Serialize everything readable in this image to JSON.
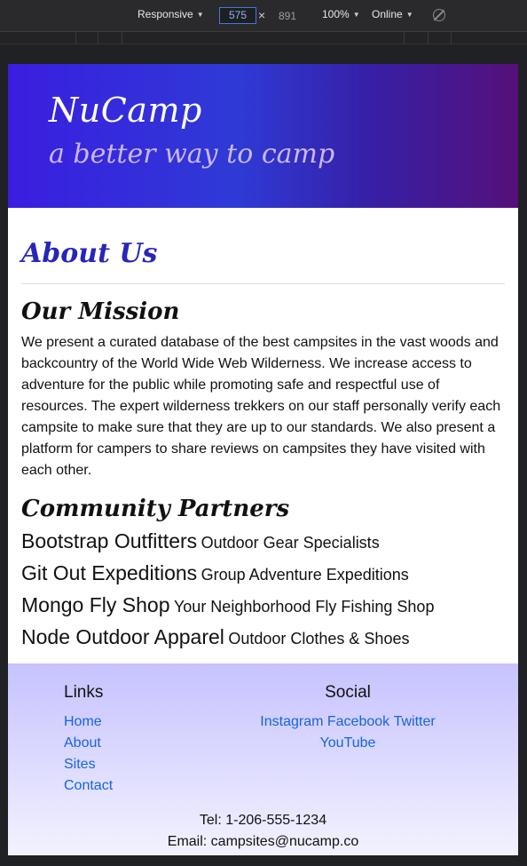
{
  "devtools": {
    "device_mode": "Responsive",
    "width_value": "575",
    "height_value": "891",
    "zoom": "100%",
    "network": "Online"
  },
  "header": {
    "brand": "NuCamp",
    "tagline": "a better way to camp"
  },
  "page": {
    "title": "About Us",
    "mission_heading": "Our Mission",
    "mission_text": "We present a curated database of the best campsites in the vast woods and backcountry of the World Wide Web Wilderness. We increase access to adventure for the public while promoting safe and respectful use of resources. The expert wilderness trekkers on our staff personally verify each campsite to make sure that they are up to our standards. We also present a platform for campers to share reviews on campsites they have visited with each other.",
    "partners_heading": "Community Partners",
    "partners": [
      {
        "name": "Bootstrap Outfitters",
        "description": "Outdoor Gear Specialists"
      },
      {
        "name": "Git Out Expeditions",
        "description": "Group Adventure Expeditions"
      },
      {
        "name": "Mongo Fly Shop",
        "description": "Your Neighborhood Fly Fishing Shop"
      },
      {
        "name": "Node Outdoor Apparel",
        "description": "Outdoor Clothes & Shoes"
      }
    ]
  },
  "footer": {
    "links_heading": "Links",
    "links": [
      "Home",
      "About",
      "Sites",
      "Contact"
    ],
    "social_heading": "Social",
    "social": [
      "Instagram",
      "Facebook",
      "Twitter",
      "YouTube"
    ],
    "phone": "Tel: 1-206-555-1234",
    "email": "Email: campsites@nucamp.co"
  }
}
